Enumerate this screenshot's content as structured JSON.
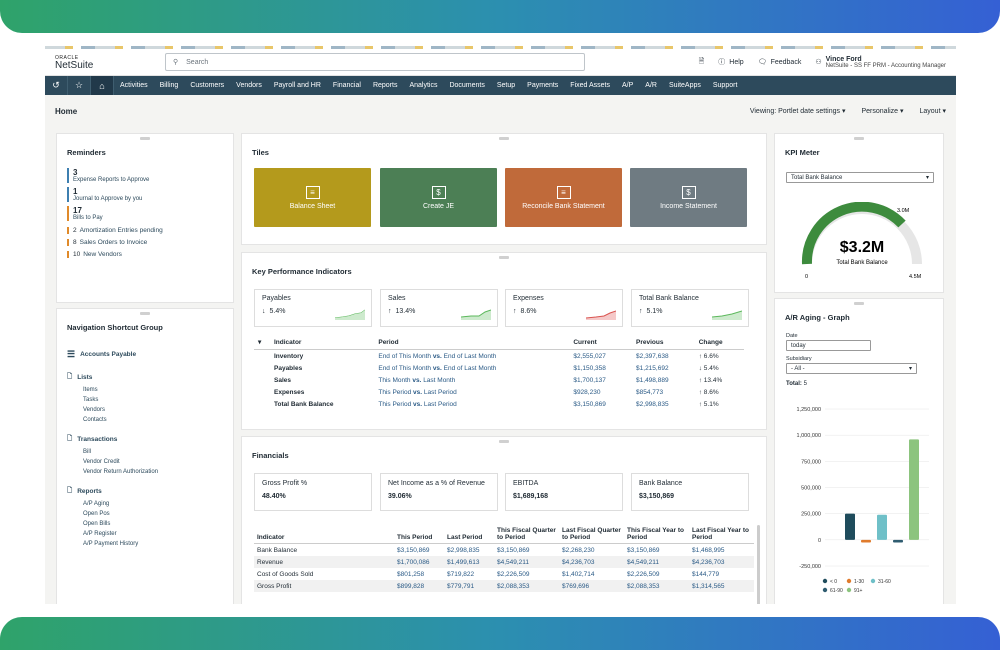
{
  "header": {
    "logo_top": "ORACLE",
    "logo_name": "NetSuite",
    "search_placeholder": "Search",
    "help": "Help",
    "feedback": "Feedback",
    "user_name": "Vince Ford",
    "user_role": "NetSuite - SS FF PRM - Accounting Manager"
  },
  "nav": {
    "items": [
      "Activities",
      "Billing",
      "Customers",
      "Vendors",
      "Payroll and HR",
      "Financial",
      "Reports",
      "Analytics",
      "Documents",
      "Setup",
      "Payments",
      "Fixed Assets",
      "A/P",
      "A/R",
      "SuiteApps",
      "Support"
    ]
  },
  "page": {
    "title": "Home",
    "viewing": "Viewing: Portlet date settings",
    "personalize": "Personalize",
    "layout": "Layout"
  },
  "reminders": {
    "title": "Reminders",
    "big": [
      {
        "count": "3",
        "label": "Expense Reports to Approve"
      },
      {
        "count": "1",
        "label": "Journal to Approve by you"
      },
      {
        "count": "17",
        "label": "Bills to Pay"
      }
    ],
    "small": [
      {
        "count": "2",
        "label": "Amortization Entries pending"
      },
      {
        "count": "8",
        "label": "Sales Orders to Invoice"
      },
      {
        "count": "10",
        "label": "New Vendors"
      }
    ]
  },
  "navgroup": {
    "title": "Navigation Shortcut Group",
    "accounts_payable": "Accounts Payable",
    "sections": [
      {
        "name": "Lists",
        "links": [
          "Items",
          "Tasks",
          "Vendors",
          "Contacts"
        ]
      },
      {
        "name": "Transactions",
        "links": [
          "Bill",
          "Vendor Credit",
          "Vendor Return Authorization"
        ]
      },
      {
        "name": "Reports",
        "links": [
          "A/P Aging",
          "Open Pos",
          "Open Bills",
          "A/P Register",
          "A/P Payment History"
        ]
      }
    ]
  },
  "tiles": {
    "title": "Tiles",
    "items": [
      {
        "label": "Balance Sheet",
        "color": "#b49a1c"
      },
      {
        "label": "Create JE",
        "color": "#4c7f55"
      },
      {
        "label": "Reconcile Bank Statement",
        "color": "#c06a3a"
      },
      {
        "label": "Income Statement",
        "color": "#6f7b82"
      }
    ]
  },
  "kpi": {
    "title": "Key Performance Indicators",
    "boxes": [
      {
        "label": "Payables",
        "arrow": "↓",
        "value": "5.4%"
      },
      {
        "label": "Sales",
        "arrow": "↑",
        "value": "13.4%"
      },
      {
        "label": "Expenses",
        "arrow": "↑",
        "value": "8.6%"
      },
      {
        "label": "Total Bank Balance",
        "arrow": "↑",
        "value": "5.1%"
      }
    ],
    "headers": [
      "Indicator",
      "Period",
      "Current",
      "Previous",
      "Change"
    ],
    "rows": [
      {
        "indicator": "Inventory",
        "p1": "End of This Month",
        "vs": "vs.",
        "p2": "End of Last Month",
        "current": "$2,555,027",
        "previous": "$2,397,638",
        "arrow": "↑",
        "change": "6.6%"
      },
      {
        "indicator": "Payables",
        "p1": "End of This Month",
        "vs": "vs.",
        "p2": "End of Last Month",
        "current": "$1,150,358",
        "previous": "$1,215,692",
        "arrow": "↓",
        "change": "5.4%"
      },
      {
        "indicator": "Sales",
        "p1": "This Month",
        "vs": "vs.",
        "p2": "Last Month",
        "current": "$1,700,137",
        "previous": "$1,498,889",
        "arrow": "↑",
        "change": "13.4%"
      },
      {
        "indicator": "Expenses",
        "p1": "This Period",
        "vs": "vs.",
        "p2": "Last Period",
        "current": "$928,230",
        "previous": "$854,773",
        "arrow": "↑",
        "change": "8.6%"
      },
      {
        "indicator": "Total Bank Balance",
        "p1": "This Period",
        "vs": "vs.",
        "p2": "Last Period",
        "current": "$3,150,869",
        "previous": "$2,998,835",
        "arrow": "↑",
        "change": "5.1%"
      }
    ]
  },
  "financials": {
    "title": "Financials",
    "boxes": [
      {
        "label": "Gross Profit %",
        "value": "48.40%"
      },
      {
        "label": "Net Income as a % of Revenue",
        "value": "39.06%"
      },
      {
        "label": "EBITDA",
        "value": "$1,689,168"
      },
      {
        "label": "Bank Balance",
        "value": "$3,150,869"
      }
    ],
    "headers": [
      "Indicator",
      "This Period",
      "Last Period",
      "This Fiscal Quarter to Period",
      "Last Fiscal Quarter to Period",
      "This Fiscal Year to Period",
      "Last Fiscal Year to Period"
    ],
    "rows": [
      [
        "Bank Balance",
        "$3,150,869",
        "$2,998,835",
        "$3,150,869",
        "$2,268,230",
        "$3,150,869",
        "$1,468,995"
      ],
      [
        "Revenue",
        "$1,700,086",
        "$1,499,613",
        "$4,549,211",
        "$4,236,703",
        "$4,549,211",
        "$4,236,703"
      ],
      [
        "Cost of Goods Sold",
        "$801,258",
        "$719,822",
        "$2,226,509",
        "$1,402,714",
        "$2,226,509",
        "$144,779"
      ],
      [
        "Gross Profit",
        "$899,828",
        "$779,791",
        "$2,088,353",
        "$769,696",
        "$2,088,353",
        "$1,314,565"
      ]
    ]
  },
  "kpimeter": {
    "title": "KPI Meter",
    "select": "Total Bank Balance",
    "value": "$3.2M",
    "label": "Total Bank Balance",
    "min": "0",
    "max": "4.5M",
    "target": "3.0M"
  },
  "aging": {
    "title": "A/R Aging - Graph",
    "date_label": "Date",
    "date_value": "today",
    "subsidiary_label": "Subsidiary",
    "subsidiary_value": "- All -",
    "total_label": "Total:",
    "total_value": "5"
  },
  "chart_data": {
    "type": "bar",
    "categories": [
      "< 0",
      "1-30",
      "31-60",
      "61-90",
      "91+"
    ],
    "values": [
      250000,
      -25000,
      240000,
      -25000,
      960000
    ],
    "colors": {
      "< 0": "#1f4c5c",
      "1-30": "#e07b2c",
      "31-60": "#6fc0c8",
      "61-90": "#2f5c70",
      "91+": "#8cc47e"
    },
    "yticks": [
      "1,250,000",
      "1,000,000",
      "750,000",
      "500,000",
      "250,000",
      "0",
      "-250,000"
    ],
    "ylim": [
      -250000,
      1250000
    ],
    "legend": [
      "< 0",
      "1-30",
      "31-60",
      "61-90",
      "91+"
    ]
  }
}
